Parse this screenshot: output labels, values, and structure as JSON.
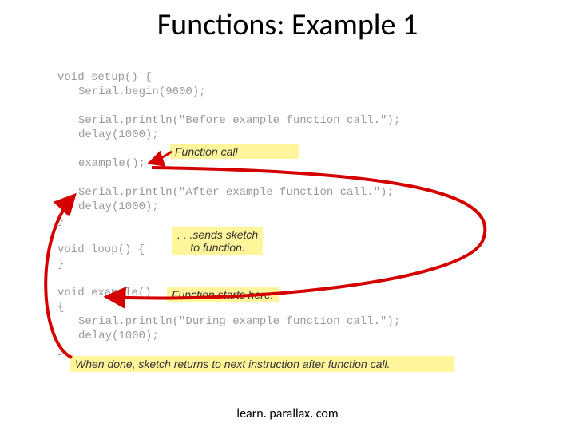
{
  "title": "Functions: Example 1",
  "footer": "learn. parallax. com",
  "code": {
    "l1": "void setup() {",
    "l2": "Serial.begin(9600);",
    "l3": "Serial.println(\"Before example function call.\");",
    "l4": "delay(1000);",
    "l5": "example();",
    "l6": "Serial.println(\"After example function call.\");",
    "l7": "delay(1000);",
    "l8": "}",
    "l9": "void loop() {",
    "l10": "}",
    "l11": "void example()",
    "l12": "{",
    "l13": "Serial.println(\"During example function call.\");",
    "l14": "delay(1000);",
    "l15": "}"
  },
  "callouts": {
    "fn_call": "Function call",
    "sends_a": ". . .sends sketch",
    "sends_b": "to function.",
    "starts": "Function starts here.",
    "returns": "When done, sketch returns to next instruction after function call."
  }
}
